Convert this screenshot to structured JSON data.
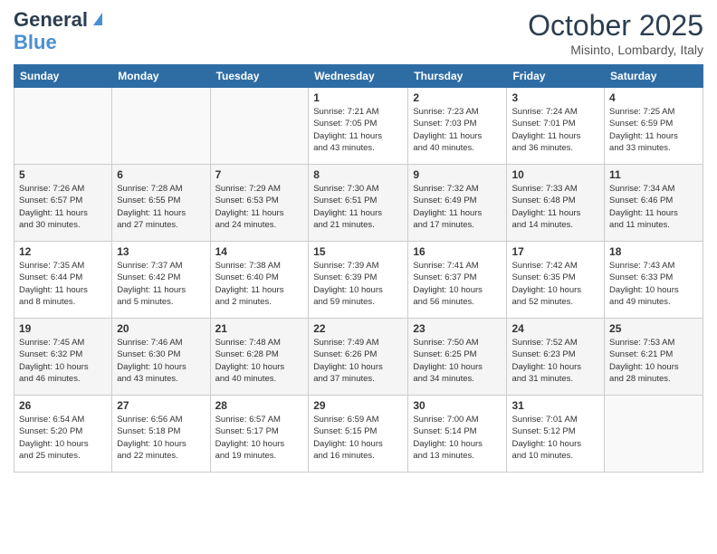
{
  "header": {
    "logo_line1": "General",
    "logo_line2": "Blue",
    "month_title": "October 2025",
    "location": "Misinto, Lombardy, Italy"
  },
  "days_of_week": [
    "Sunday",
    "Monday",
    "Tuesday",
    "Wednesday",
    "Thursday",
    "Friday",
    "Saturday"
  ],
  "weeks": [
    [
      {
        "day": "",
        "info": ""
      },
      {
        "day": "",
        "info": ""
      },
      {
        "day": "",
        "info": ""
      },
      {
        "day": "1",
        "info": "Sunrise: 7:21 AM\nSunset: 7:05 PM\nDaylight: 11 hours\nand 43 minutes."
      },
      {
        "day": "2",
        "info": "Sunrise: 7:23 AM\nSunset: 7:03 PM\nDaylight: 11 hours\nand 40 minutes."
      },
      {
        "day": "3",
        "info": "Sunrise: 7:24 AM\nSunset: 7:01 PM\nDaylight: 11 hours\nand 36 minutes."
      },
      {
        "day": "4",
        "info": "Sunrise: 7:25 AM\nSunset: 6:59 PM\nDaylight: 11 hours\nand 33 minutes."
      }
    ],
    [
      {
        "day": "5",
        "info": "Sunrise: 7:26 AM\nSunset: 6:57 PM\nDaylight: 11 hours\nand 30 minutes."
      },
      {
        "day": "6",
        "info": "Sunrise: 7:28 AM\nSunset: 6:55 PM\nDaylight: 11 hours\nand 27 minutes."
      },
      {
        "day": "7",
        "info": "Sunrise: 7:29 AM\nSunset: 6:53 PM\nDaylight: 11 hours\nand 24 minutes."
      },
      {
        "day": "8",
        "info": "Sunrise: 7:30 AM\nSunset: 6:51 PM\nDaylight: 11 hours\nand 21 minutes."
      },
      {
        "day": "9",
        "info": "Sunrise: 7:32 AM\nSunset: 6:49 PM\nDaylight: 11 hours\nand 17 minutes."
      },
      {
        "day": "10",
        "info": "Sunrise: 7:33 AM\nSunset: 6:48 PM\nDaylight: 11 hours\nand 14 minutes."
      },
      {
        "day": "11",
        "info": "Sunrise: 7:34 AM\nSunset: 6:46 PM\nDaylight: 11 hours\nand 11 minutes."
      }
    ],
    [
      {
        "day": "12",
        "info": "Sunrise: 7:35 AM\nSunset: 6:44 PM\nDaylight: 11 hours\nand 8 minutes."
      },
      {
        "day": "13",
        "info": "Sunrise: 7:37 AM\nSunset: 6:42 PM\nDaylight: 11 hours\nand 5 minutes."
      },
      {
        "day": "14",
        "info": "Sunrise: 7:38 AM\nSunset: 6:40 PM\nDaylight: 11 hours\nand 2 minutes."
      },
      {
        "day": "15",
        "info": "Sunrise: 7:39 AM\nSunset: 6:39 PM\nDaylight: 10 hours\nand 59 minutes."
      },
      {
        "day": "16",
        "info": "Sunrise: 7:41 AM\nSunset: 6:37 PM\nDaylight: 10 hours\nand 56 minutes."
      },
      {
        "day": "17",
        "info": "Sunrise: 7:42 AM\nSunset: 6:35 PM\nDaylight: 10 hours\nand 52 minutes."
      },
      {
        "day": "18",
        "info": "Sunrise: 7:43 AM\nSunset: 6:33 PM\nDaylight: 10 hours\nand 49 minutes."
      }
    ],
    [
      {
        "day": "19",
        "info": "Sunrise: 7:45 AM\nSunset: 6:32 PM\nDaylight: 10 hours\nand 46 minutes."
      },
      {
        "day": "20",
        "info": "Sunrise: 7:46 AM\nSunset: 6:30 PM\nDaylight: 10 hours\nand 43 minutes."
      },
      {
        "day": "21",
        "info": "Sunrise: 7:48 AM\nSunset: 6:28 PM\nDaylight: 10 hours\nand 40 minutes."
      },
      {
        "day": "22",
        "info": "Sunrise: 7:49 AM\nSunset: 6:26 PM\nDaylight: 10 hours\nand 37 minutes."
      },
      {
        "day": "23",
        "info": "Sunrise: 7:50 AM\nSunset: 6:25 PM\nDaylight: 10 hours\nand 34 minutes."
      },
      {
        "day": "24",
        "info": "Sunrise: 7:52 AM\nSunset: 6:23 PM\nDaylight: 10 hours\nand 31 minutes."
      },
      {
        "day": "25",
        "info": "Sunrise: 7:53 AM\nSunset: 6:21 PM\nDaylight: 10 hours\nand 28 minutes."
      }
    ],
    [
      {
        "day": "26",
        "info": "Sunrise: 6:54 AM\nSunset: 5:20 PM\nDaylight: 10 hours\nand 25 minutes."
      },
      {
        "day": "27",
        "info": "Sunrise: 6:56 AM\nSunset: 5:18 PM\nDaylight: 10 hours\nand 22 minutes."
      },
      {
        "day": "28",
        "info": "Sunrise: 6:57 AM\nSunset: 5:17 PM\nDaylight: 10 hours\nand 19 minutes."
      },
      {
        "day": "29",
        "info": "Sunrise: 6:59 AM\nSunset: 5:15 PM\nDaylight: 10 hours\nand 16 minutes."
      },
      {
        "day": "30",
        "info": "Sunrise: 7:00 AM\nSunset: 5:14 PM\nDaylight: 10 hours\nand 13 minutes."
      },
      {
        "day": "31",
        "info": "Sunrise: 7:01 AM\nSunset: 5:12 PM\nDaylight: 10 hours\nand 10 minutes."
      },
      {
        "day": "",
        "info": ""
      }
    ]
  ]
}
